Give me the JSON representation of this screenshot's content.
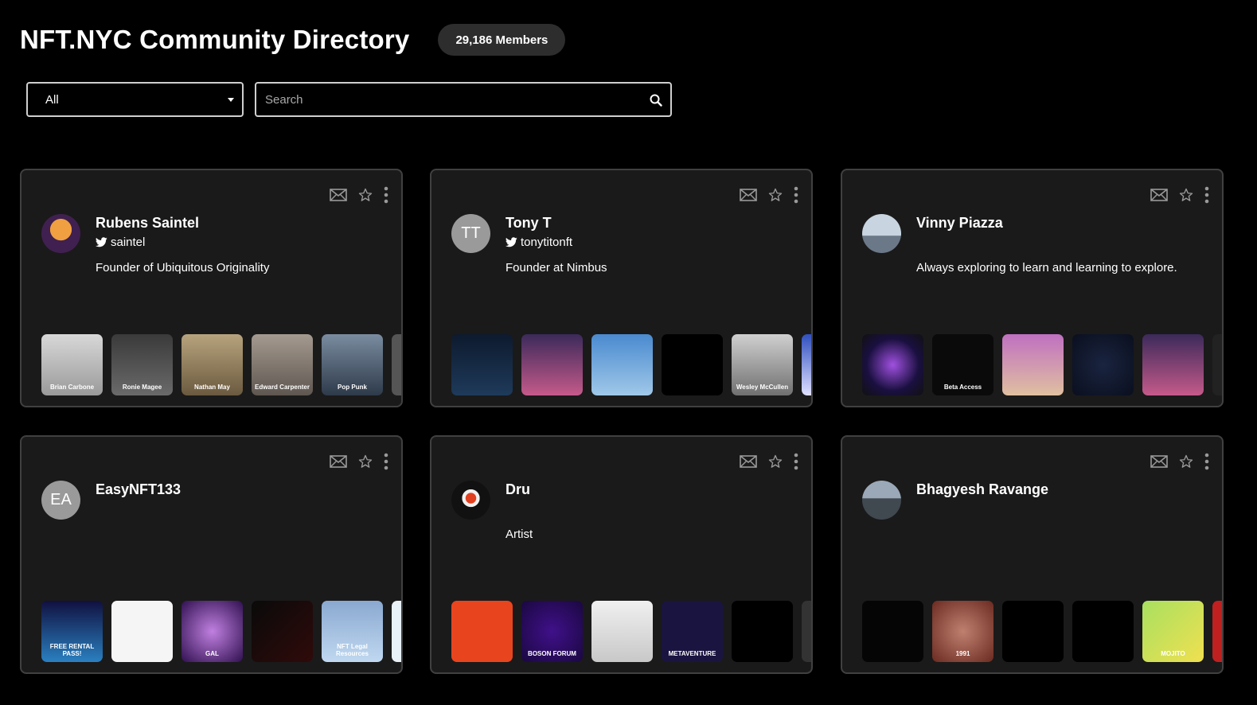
{
  "header": {
    "title": "NFT.NYC Community Directory",
    "members": "29,186 Members"
  },
  "filter": {
    "selected": "All"
  },
  "search": {
    "placeholder": "Search"
  },
  "colors": {
    "background": "#000000",
    "card": "#1a1a1a",
    "card_border": "#404040",
    "badge": "#2d2d2d"
  },
  "cards": [
    {
      "name": "Rubens Saintel",
      "handle": "saintel",
      "bio": "Founder of Ubiquitous Originality",
      "avatar_initials": "",
      "thumbs": [
        {
          "bg": "linear-gradient(#d8d8d8,#9a9a9a)",
          "label": "Brian Carbone"
        },
        {
          "bg": "linear-gradient(#3a3a3a,#6a6a6a)",
          "label": "Ronie Magee"
        },
        {
          "bg": "linear-gradient(#b7a37d,#6b5a3f)",
          "label": "Nathan May"
        },
        {
          "bg": "linear-gradient(#a59a90,#5e5650)",
          "label": "Edward Carpenter"
        },
        {
          "bg": "linear-gradient(#7a8ca0,#2e3a4a)",
          "label": "Pop Punk"
        },
        {
          "bg": "#555",
          "label": ""
        }
      ]
    },
    {
      "name": "Tony T",
      "handle": "tonytitonft",
      "bio": "Founder at Nimbus",
      "avatar_initials": "TT",
      "thumbs": [
        {
          "bg": "linear-gradient(#0d1a2e,#1e3a5a)",
          "label": ""
        },
        {
          "bg": "linear-gradient(#3b2a5a,#c55a8a)",
          "label": ""
        },
        {
          "bg": "linear-gradient(#4a8ad0,#a0c8e8)",
          "label": ""
        },
        {
          "bg": "#000",
          "label": ""
        },
        {
          "bg": "linear-gradient(#d0d0d0,#707070)",
          "label": "Wesley McCullen"
        },
        {
          "bg": "linear-gradient(#3050c0,#e0e0ff)",
          "label": ""
        }
      ]
    },
    {
      "name": "Vinny Piazza",
      "handle": "",
      "bio": "Always exploring to learn and learning to explore.",
      "avatar_initials": "",
      "thumbs": [
        {
          "bg": "radial-gradient(circle,#a050e0,#1a1040 60%,#111)",
          "label": ""
        },
        {
          "bg": "#0a0a0a",
          "label": "Beta Access"
        },
        {
          "bg": "linear-gradient(#c070c0,#e0c0a0)",
          "label": ""
        },
        {
          "bg": "radial-gradient(circle,#1a2440,#0a0f1e)",
          "label": ""
        },
        {
          "bg": "linear-gradient(#3b2a5a,#c55a8a)",
          "label": ""
        },
        {
          "bg": "#222",
          "label": ""
        }
      ]
    },
    {
      "name": "EasyNFT133",
      "handle": "",
      "bio": "",
      "avatar_initials": "EA",
      "thumbs": [
        {
          "bg": "linear-gradient(#101040,#2a80c0)",
          "label": "FREE RENTAL PASS!"
        },
        {
          "bg": "#f5f5f5",
          "label": ""
        },
        {
          "bg": "radial-gradient(circle,#c080e0,#301050)",
          "label": "GAL"
        },
        {
          "bg": "linear-gradient(135deg,#0a0a0a,#300a0a)",
          "label": ""
        },
        {
          "bg": "linear-gradient(#8aa8d0,#c0d8f0)",
          "label": "NFT Legal Resources"
        },
        {
          "bg": "#e8f0f8",
          "label": ""
        }
      ]
    },
    {
      "name": "Dru",
      "handle": "",
      "bio": "Artist",
      "avatar_initials": "",
      "thumbs": [
        {
          "bg": "#e8451f",
          "label": ""
        },
        {
          "bg": "radial-gradient(circle,#40108a,#1a0840)",
          "label": "BOSON FORUM"
        },
        {
          "bg": "linear-gradient(#f0f0f0,#c8c8c8)",
          "label": ""
        },
        {
          "bg": "#1a1440",
          "label": "METAVENTURE"
        },
        {
          "bg": "#000",
          "label": ""
        },
        {
          "bg": "#333",
          "label": ""
        }
      ]
    },
    {
      "name": "Bhagyesh Ravange",
      "handle": "",
      "bio": "",
      "avatar_initials": "",
      "thumbs": [
        {
          "bg": "#050505",
          "label": ""
        },
        {
          "bg": "radial-gradient(circle,#c08070,#6a2a20)",
          "label": "1991"
        },
        {
          "bg": "#000",
          "label": ""
        },
        {
          "bg": "#000",
          "label": ""
        },
        {
          "bg": "linear-gradient(135deg,#a8e060,#f0e050)",
          "label": "MOJITO"
        },
        {
          "bg": "#c02020",
          "label": ""
        }
      ]
    }
  ]
}
